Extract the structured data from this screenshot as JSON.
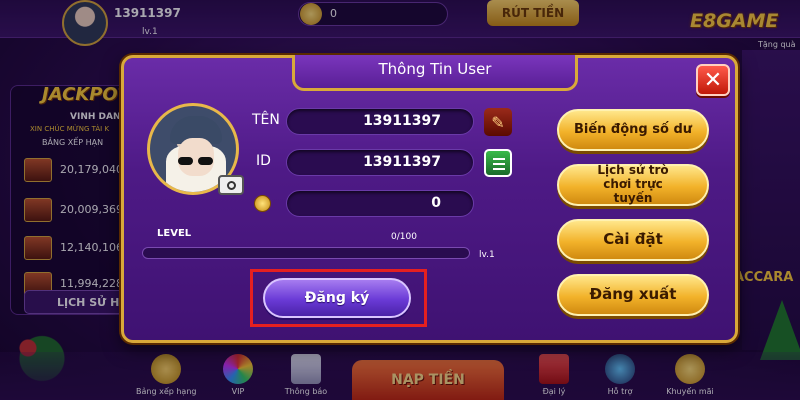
{
  "topbar": {
    "user_id": "13911397",
    "level": "lv.1",
    "coins": "0",
    "withdraw_label": "RÚT TIỀN",
    "logo_text": "E8GAME",
    "gift_label": "Tặng quà"
  },
  "left_panel": {
    "jackpot_label": "JACKPOT",
    "honor_title": "VINH DANH",
    "congrats_text": "XIN CHÚC MỪNG TÀI K",
    "rank_title": "BẢNG XẾP HẠN",
    "rankings": [
      "20,179,040",
      "20,009,369",
      "12,140,106",
      "11,994,228"
    ],
    "history_label": "LỊCH SỬ H"
  },
  "bottom_nav": {
    "items": [
      {
        "label": "Bảng xếp hạng",
        "icon": "trophy-icon"
      },
      {
        "label": "VIP",
        "icon": "vip-wheel-icon"
      },
      {
        "label": "Thông báo",
        "icon": "notification-icon"
      },
      {
        "label": "Đại lý",
        "icon": "gift-icon"
      },
      {
        "label": "Hỗ trợ",
        "icon": "support-icon"
      },
      {
        "label": "Khuyến mãi",
        "icon": "promo-coin-icon"
      }
    ],
    "deposit_label": "NẠP TIỀN"
  },
  "right_deco": {
    "baccarat_label": "ACCARA"
  },
  "modal": {
    "title": "Thông Tin User",
    "name_label": "TÊN",
    "name_value": "13911397",
    "id_label": "ID",
    "id_value": "13911397",
    "balance_value": "0",
    "level_label": "LEVEL",
    "level_progress": "0/100",
    "level_fraction": 0,
    "level_tag": "lv.1",
    "register_label": "Đăng ký",
    "buttons": {
      "balance_history": "Biến động số dư",
      "game_history": "Lịch sử trò chơi trực tuyến",
      "settings": "Cài đặt",
      "logout": "Đăng xuất"
    }
  },
  "colors": {
    "accent_gold": "#d9a93a",
    "modal_purple": "#4e1a86",
    "highlight_red": "#e52020",
    "register_purple": "#6a3ad6"
  }
}
